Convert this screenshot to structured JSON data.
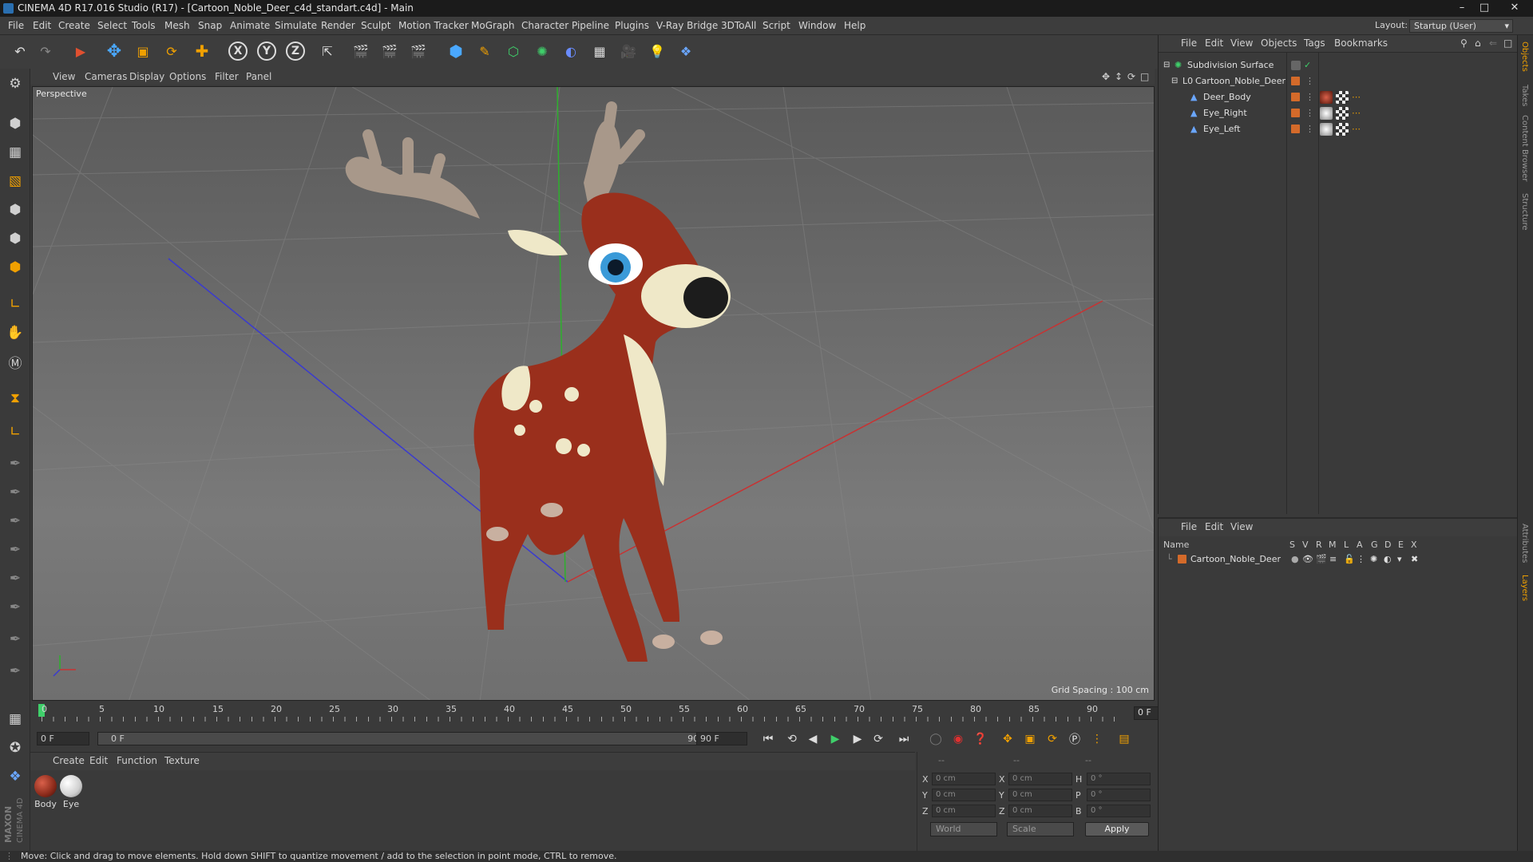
{
  "window": {
    "title": "CINEMA 4D R17.016 Studio (R17) - [Cartoon_Noble_Deer_c4d_standart.c4d] - Main"
  },
  "menubar": {
    "items": [
      "File",
      "Edit",
      "Create",
      "Select",
      "Tools",
      "Mesh",
      "Snap",
      "Animate",
      "Simulate",
      "Render",
      "Sculpt",
      "Motion Tracker",
      "MoGraph",
      "Character",
      "Pipeline",
      "Plugins",
      "V-Ray Bridge",
      "3DToAll",
      "Script",
      "Window",
      "Help"
    ],
    "layout_label": "Layout:",
    "layout_value": "Startup (User)"
  },
  "toolbar": {
    "axes": [
      "X",
      "Y",
      "Z"
    ]
  },
  "viewport": {
    "menu": [
      "View",
      "Cameras",
      "Display",
      "Options",
      "Filter",
      "Panel"
    ],
    "camera_label": "Perspective",
    "grid_spacing": "Grid Spacing : 100 cm"
  },
  "timeline": {
    "ticks": [
      "0",
      "5",
      "10",
      "15",
      "20",
      "25",
      "30",
      "35",
      "40",
      "45",
      "50",
      "55",
      "60",
      "65",
      "70",
      "75",
      "80",
      "85",
      "90"
    ],
    "current_frame": "0 F"
  },
  "playback": {
    "start_field": "0 F",
    "range_start": "0 F",
    "range_end": "90 F",
    "end_field": "90 F"
  },
  "materials": {
    "menu": [
      "Create",
      "Edit",
      "Function",
      "Texture"
    ],
    "items": [
      {
        "name": "Body",
        "color": "#8a2a1a"
      },
      {
        "name": "Eye",
        "color": "#e8e8e8"
      }
    ]
  },
  "coordinates": {
    "headers": [
      "--",
      "--",
      "--"
    ],
    "rows": [
      {
        "a": "X",
        "av": "0 cm",
        "b": "X",
        "bv": "0 cm",
        "c": "H",
        "cv": "0 °"
      },
      {
        "a": "Y",
        "av": "0 cm",
        "b": "Y",
        "bv": "0 cm",
        "c": "P",
        "cv": "0 °"
      },
      {
        "a": "Z",
        "av": "0 cm",
        "b": "Z",
        "bv": "0 cm",
        "c": "B",
        "cv": "0 °"
      }
    ],
    "mode1": "World",
    "mode2": "Scale",
    "apply": "Apply"
  },
  "objects_panel": {
    "menu": [
      "File",
      "Edit",
      "View",
      "Objects",
      "Tags",
      "Bookmarks"
    ],
    "tree": [
      {
        "name": "Subdivision Surface",
        "indent": 0
      },
      {
        "name": "Cartoon_Noble_Deer",
        "indent": 1
      },
      {
        "name": "Deer_Body",
        "indent": 2
      },
      {
        "name": "Eye_Right",
        "indent": 2
      },
      {
        "name": "Eye_Left",
        "indent": 2
      }
    ]
  },
  "layers_panel": {
    "menu": [
      "File",
      "Edit",
      "View"
    ],
    "columns": [
      "Name",
      "S",
      "V",
      "R",
      "M",
      "L",
      "A",
      "G",
      "D",
      "E",
      "X"
    ],
    "layers": [
      {
        "name": "Cartoon_Noble_Deer"
      }
    ]
  },
  "right_tabs": [
    "Objects",
    "Takes",
    "Content Browser",
    "Structure",
    "Attributes",
    "Layers"
  ],
  "statusbar": {
    "text": "Move: Click and drag to move elements. Hold down SHIFT to quantize movement / add to the selection in point mode, CTRL to remove."
  },
  "logo": {
    "text": "MAXON CINEMA 4D"
  },
  "colors": {
    "accent_orange": "#f0a000",
    "object_dot": "#d46a2a",
    "deer_body": "#9a2f1c"
  }
}
